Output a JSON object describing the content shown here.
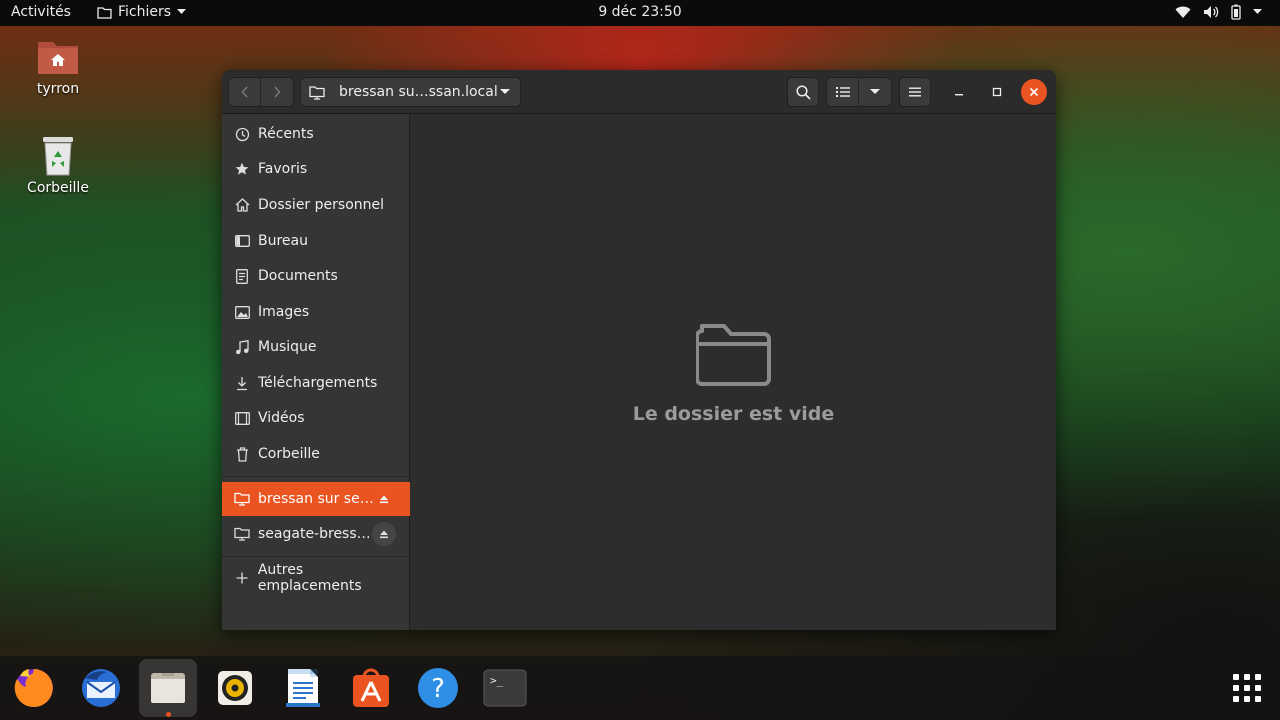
{
  "topbar": {
    "activities": "Activités",
    "app_menu": "Fichiers",
    "clock": "9 déc  23:50"
  },
  "desktop": {
    "icons": [
      {
        "label": "tyrron",
        "icon": "home-folder-icon"
      },
      {
        "label": "Corbeille",
        "icon": "trash-icon"
      }
    ]
  },
  "window": {
    "path_label": "bressan su…ssan.local",
    "empty_message": "Le dossier est vide"
  },
  "sidebar": {
    "items": [
      {
        "label": "Récents",
        "icon": "recent-icon"
      },
      {
        "label": "Favoris",
        "icon": "star-icon"
      },
      {
        "label": "Dossier personnel",
        "icon": "home-icon"
      },
      {
        "label": "Bureau",
        "icon": "desktop-icon"
      },
      {
        "label": "Documents",
        "icon": "documents-icon"
      },
      {
        "label": "Images",
        "icon": "images-icon"
      },
      {
        "label": "Musique",
        "icon": "music-icon"
      },
      {
        "label": "Téléchargements",
        "icon": "downloads-icon"
      },
      {
        "label": "Vidéos",
        "icon": "videos-icon"
      },
      {
        "label": "Corbeille",
        "icon": "trash-icon"
      }
    ],
    "network": [
      {
        "label": "bressan sur se…",
        "icon": "network-folder-icon",
        "active": true
      },
      {
        "label": "seagate-bress…",
        "icon": "network-folder-icon",
        "active": false
      }
    ],
    "other_locations": "Autres emplacements"
  },
  "dock": {
    "apps": [
      "firefox-icon",
      "thunderbird-icon",
      "files-icon",
      "rhythmbox-icon",
      "writer-icon",
      "software-icon",
      "help-icon",
      "terminal-icon"
    ],
    "help_glyph": "?",
    "terminal_glyph": ">_"
  },
  "colors": {
    "accent": "#e95420",
    "sidebar_bg": "#353535",
    "content_bg": "#2d2d2d",
    "topbar_bg": "#0b0b0b"
  }
}
